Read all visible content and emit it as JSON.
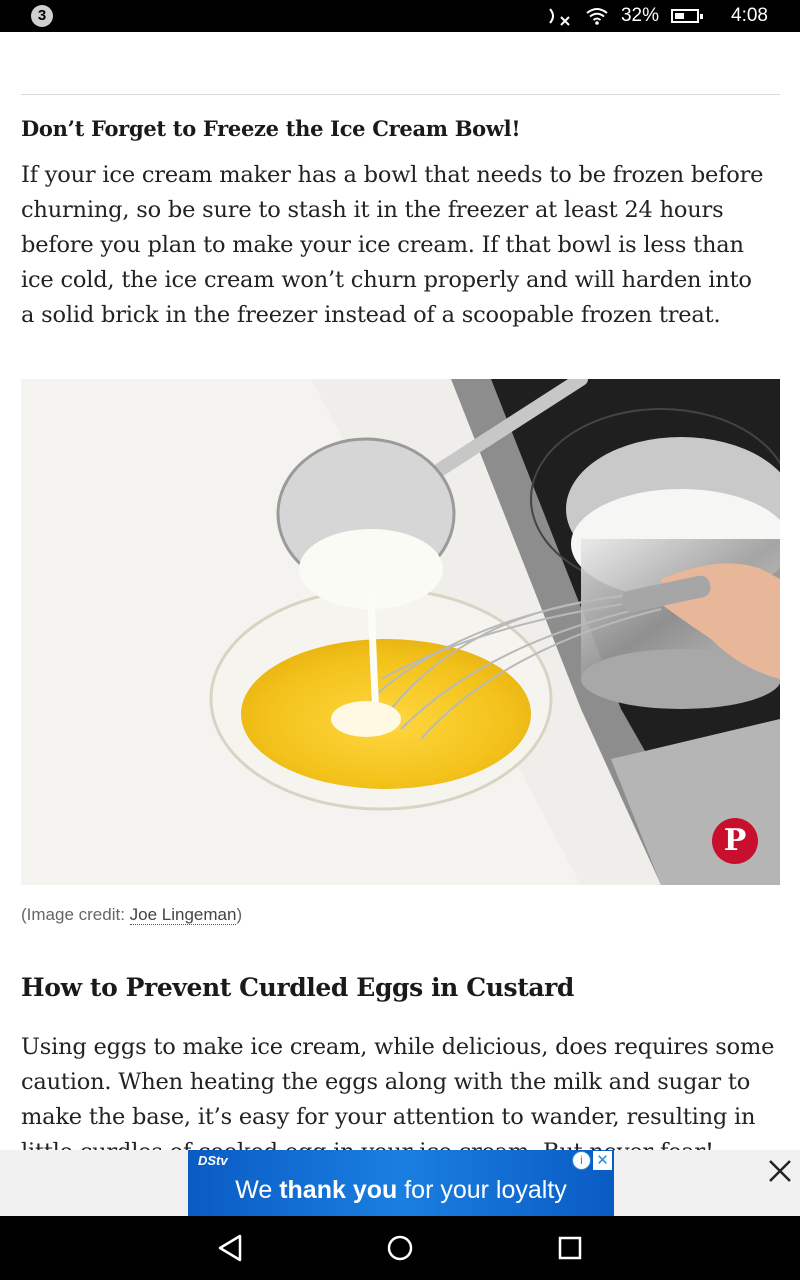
{
  "status_bar": {
    "notification_count": "3",
    "battery_percent": "32%",
    "time": "4:08",
    "icons": [
      "no-sound-icon",
      "wifi-icon",
      "battery-icon"
    ]
  },
  "article": {
    "subhead": "Don’t Forget to Freeze the Ice Cream Bowl!",
    "paragraph1": [
      "If your ice cream maker has a bowl that needs to be frozen before",
      "churning, so be sure to stash it in the freezer at least 24 hours",
      "before you plan to make your ice cream. If that bowl is less than",
      "ice cold, the ice cream won’t churn properly and will harden into",
      "a solid brick in the freezer instead of a scoopable frozen treat."
    ],
    "image_credit_prefix": "(Image credit: ",
    "image_credit_name": "Joe Lingeman",
    "image_credit_suffix": ")",
    "heading2": "How to Prevent Curdled Eggs in Custard",
    "paragraph2": [
      "Using eggs to make ice cream, while delicious, does requires some",
      "caution. When heating the eggs along with the milk and sugar to",
      "make the base, it’s easy for your attention to wander, resulting in",
      "little curdles of cooked egg in your ice cream. But never fear!"
    ]
  },
  "pinterest": {
    "glyph": "P"
  },
  "ad": {
    "brand": "DStv",
    "text_pre": "We ",
    "text_bold": "thank you",
    "text_post": " for your loyalty",
    "info_glyph": "i",
    "x_glyph": "✕"
  },
  "colors": {
    "pinterest": "#c8102e",
    "ad_blue": "#1a7fe0"
  }
}
